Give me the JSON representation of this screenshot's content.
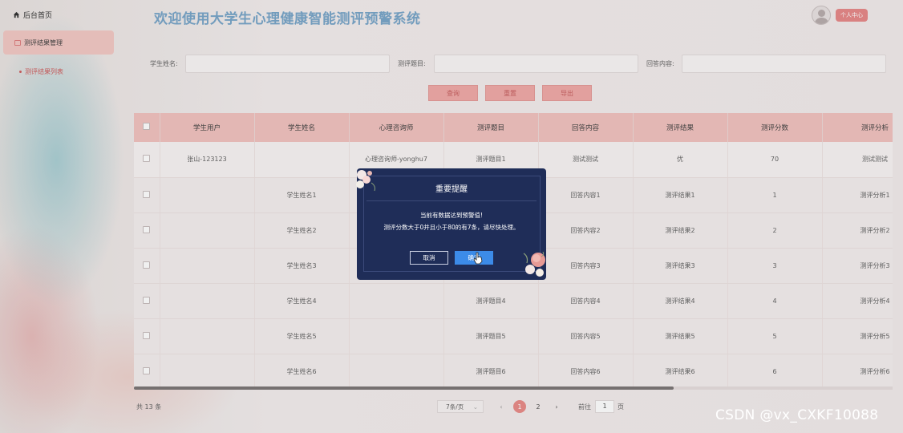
{
  "sidebar": {
    "home": "后台首页",
    "menu": "测评结果管理",
    "submenu": "测评结果列表"
  },
  "header": {
    "title": "欢迎使用大学生心理健康智能测评预警系统",
    "profile": "个人中心"
  },
  "search": {
    "fields": [
      {
        "label": "学生姓名:",
        "value": ""
      },
      {
        "label": "测评题目:",
        "value": ""
      },
      {
        "label": "回答内容:",
        "value": ""
      }
    ],
    "buttons": {
      "query": "查询",
      "reset": "重置",
      "export": "导出"
    }
  },
  "table": {
    "columns": [
      "学生用户",
      "学生姓名",
      "心理咨询师",
      "测评题目",
      "回答内容",
      "测评结果",
      "测评分数",
      "测评分析"
    ],
    "rows": [
      [
        "张山-123123",
        "",
        "心理咨询师-yonghu7",
        "测评题目1",
        "测试测试",
        "优",
        "70",
        "测试测试"
      ],
      [
        "",
        "学生姓名1",
        "",
        "",
        "回答内容1",
        "测评结果1",
        "1",
        "测评分析1"
      ],
      [
        "",
        "学生姓名2",
        "",
        "",
        "回答内容2",
        "测评结果2",
        "2",
        "测评分析2"
      ],
      [
        "",
        "学生姓名3",
        "",
        "",
        "回答内容3",
        "测评结果3",
        "3",
        "测评分析3"
      ],
      [
        "",
        "学生姓名4",
        "",
        "测评题目4",
        "回答内容4",
        "测评结果4",
        "4",
        "测评分析4"
      ],
      [
        "",
        "学生姓名5",
        "",
        "测评题目5",
        "回答内容5",
        "测评结果5",
        "5",
        "测评分析5"
      ],
      [
        "",
        "学生姓名6",
        "",
        "测评题目6",
        "回答内容6",
        "测评结果6",
        "6",
        "测评分析6"
      ]
    ]
  },
  "pagination": {
    "total": "共 13 条",
    "page_size": "7条/页",
    "pages": [
      "1",
      "2"
    ],
    "current": "1",
    "goto_label": "前往",
    "goto_value": "1",
    "page_suffix": "页"
  },
  "modal": {
    "title": "重要提醒",
    "line1": "当前有数据达到预警值!",
    "line2": "测评分数大于0并且小于80的有7条，请尽快处理。",
    "cancel": "取消",
    "confirm": "确定"
  },
  "watermark": "CSDN @vx_CXKF10088",
  "colors": {
    "accent": "#e98d8a",
    "modal_bg": "#1f2d58",
    "primary": "#3c8be8",
    "title": "#7aa6c9"
  }
}
